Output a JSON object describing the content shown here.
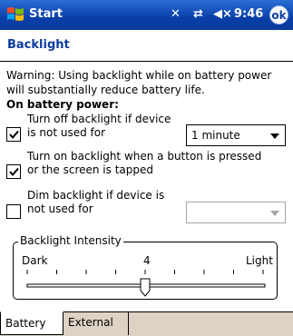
{
  "titlebar": {
    "app_title": "Start",
    "icons": [
      "connectivity-icon",
      "sync-icon",
      "volume-icon"
    ],
    "time": "9:46",
    "ok_label": "ok",
    "accent": "#0a3fa8"
  },
  "page": {
    "heading": "Backlight",
    "warning": "Warning: Using backlight while on battery power will substantially reduce battery life.",
    "section_label": "On battery power:"
  },
  "options": {
    "turn_off": {
      "checked": true,
      "label": "Turn off backlight if device is not used for",
      "dropdown_value": "1 minute"
    },
    "turn_on": {
      "checked": true,
      "label": "Turn on backlight when a button is pressed or the screen is tapped"
    },
    "dim": {
      "checked": false,
      "label": "Dim backlight if device is not used for",
      "dropdown_value": ""
    }
  },
  "intensity": {
    "group_label": "Backlight Intensity",
    "min_label": "Dark",
    "max_label": "Light",
    "value_label": "4",
    "ticks": 9,
    "level_fraction": 0.5
  },
  "tabs": [
    {
      "label": "Battery",
      "active": true
    },
    {
      "label": "External",
      "active": false
    }
  ]
}
